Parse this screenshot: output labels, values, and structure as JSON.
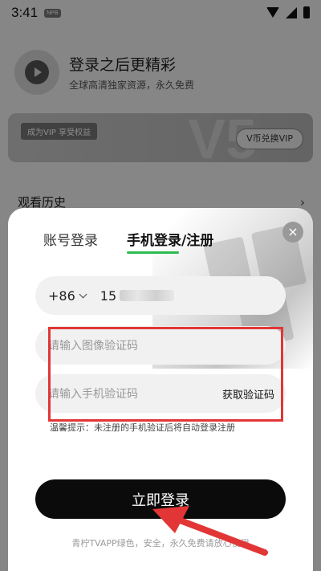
{
  "status_bar": {
    "time": "3:41",
    "badge": "NPB"
  },
  "hero": {
    "title": "登录之后更精彩",
    "subtitle": "全球高清独家资源，永久免费"
  },
  "vip_card": {
    "tag": "成为VIP 享受权益",
    "watermark": "V5",
    "redeem_button": "V币兑换VIP"
  },
  "history": {
    "label": "观看历史",
    "arrow": "›"
  },
  "login_sheet": {
    "tabs": [
      {
        "label": "账号登录",
        "active": false
      },
      {
        "label": "手机登录/注册",
        "active": true
      }
    ],
    "close_glyph": "×",
    "phone": {
      "country_code": "+86",
      "prefix": "15"
    },
    "captcha_placeholder": "请输入图像验证码",
    "sms_placeholder": "请输入手机验证码",
    "get_code_label": "获取验证码",
    "tip": "温馨提示：未注册的手机验证后将自动登录注册",
    "login_button": "立即登录",
    "footer_note": "青柠TVAPP绿色，安全，永久免费请放心使用"
  },
  "annotation": {
    "color": "#e23636"
  },
  "accent_color": "#2dbb50"
}
